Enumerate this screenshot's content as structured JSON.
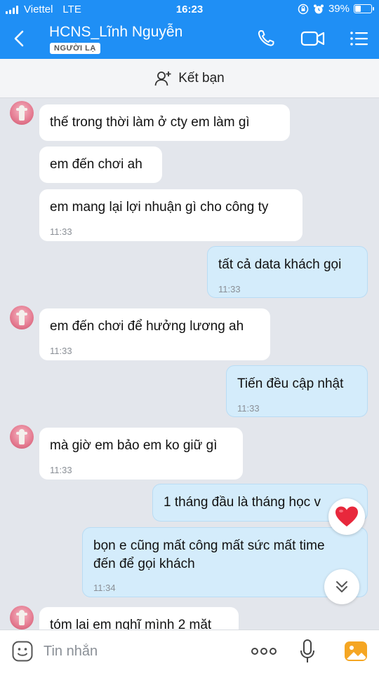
{
  "status_bar": {
    "carrier": "Viettel",
    "network": "LTE",
    "time": "16:23",
    "battery_percent": "39%",
    "battery_level": 0.39
  },
  "header": {
    "title": "HCNS_Lĩnh Nguyễn",
    "badge": "NGƯỜI LẠ",
    "background_color": "#1f8ff5"
  },
  "friend_bar": {
    "label": "Kết bạn"
  },
  "messages": [
    {
      "direction": "in",
      "lines": [
        "thế  trong thời  làm ở cty em làm gì"
      ],
      "time": ""
    },
    {
      "direction": "in",
      "lines": [
        "em đến chơi ah"
      ],
      "time": ""
    },
    {
      "direction": "in",
      "lines": [
        "em mang lại lợi nhuận gì cho công ty"
      ],
      "time": "11:33"
    },
    {
      "direction": "out",
      "lines": [
        "tất cả data khách gọi"
      ],
      "time": "11:33"
    },
    {
      "direction": "in",
      "lines": [
        "em đến chơi để hưởng lương ah"
      ],
      "time": "11:33"
    },
    {
      "direction": "out",
      "lines": [
        "Tiến đều cập nhật"
      ],
      "time": "11:33"
    },
    {
      "direction": "in",
      "lines": [
        "mà giờ em bảo em ko giữ gì"
      ],
      "time": "11:33"
    },
    {
      "direction": "out",
      "lines": [
        "1 tháng đầu là tháng học v"
      ],
      "time": ""
    },
    {
      "direction": "out",
      "lines": [
        "bọn e cũng mất công mất sức mất time",
        "đến để gọi khách"
      ],
      "time": "11:34"
    },
    {
      "direction": "in",
      "lines": [
        "tóm lại em nghĩ mình 2 mặt"
      ],
      "time": ""
    }
  ],
  "reaction": {
    "icon": "heart-icon",
    "color": "#e8283c"
  },
  "input": {
    "placeholder": "Tin nhắn",
    "value": ""
  },
  "colors": {
    "accent": "#1f8ff5",
    "outgoing_bubble": "#d4ecfb",
    "incoming_bubble": "#ffffff",
    "chat_background": "#e3e6ec",
    "gallery_icon": "#f5a623"
  }
}
